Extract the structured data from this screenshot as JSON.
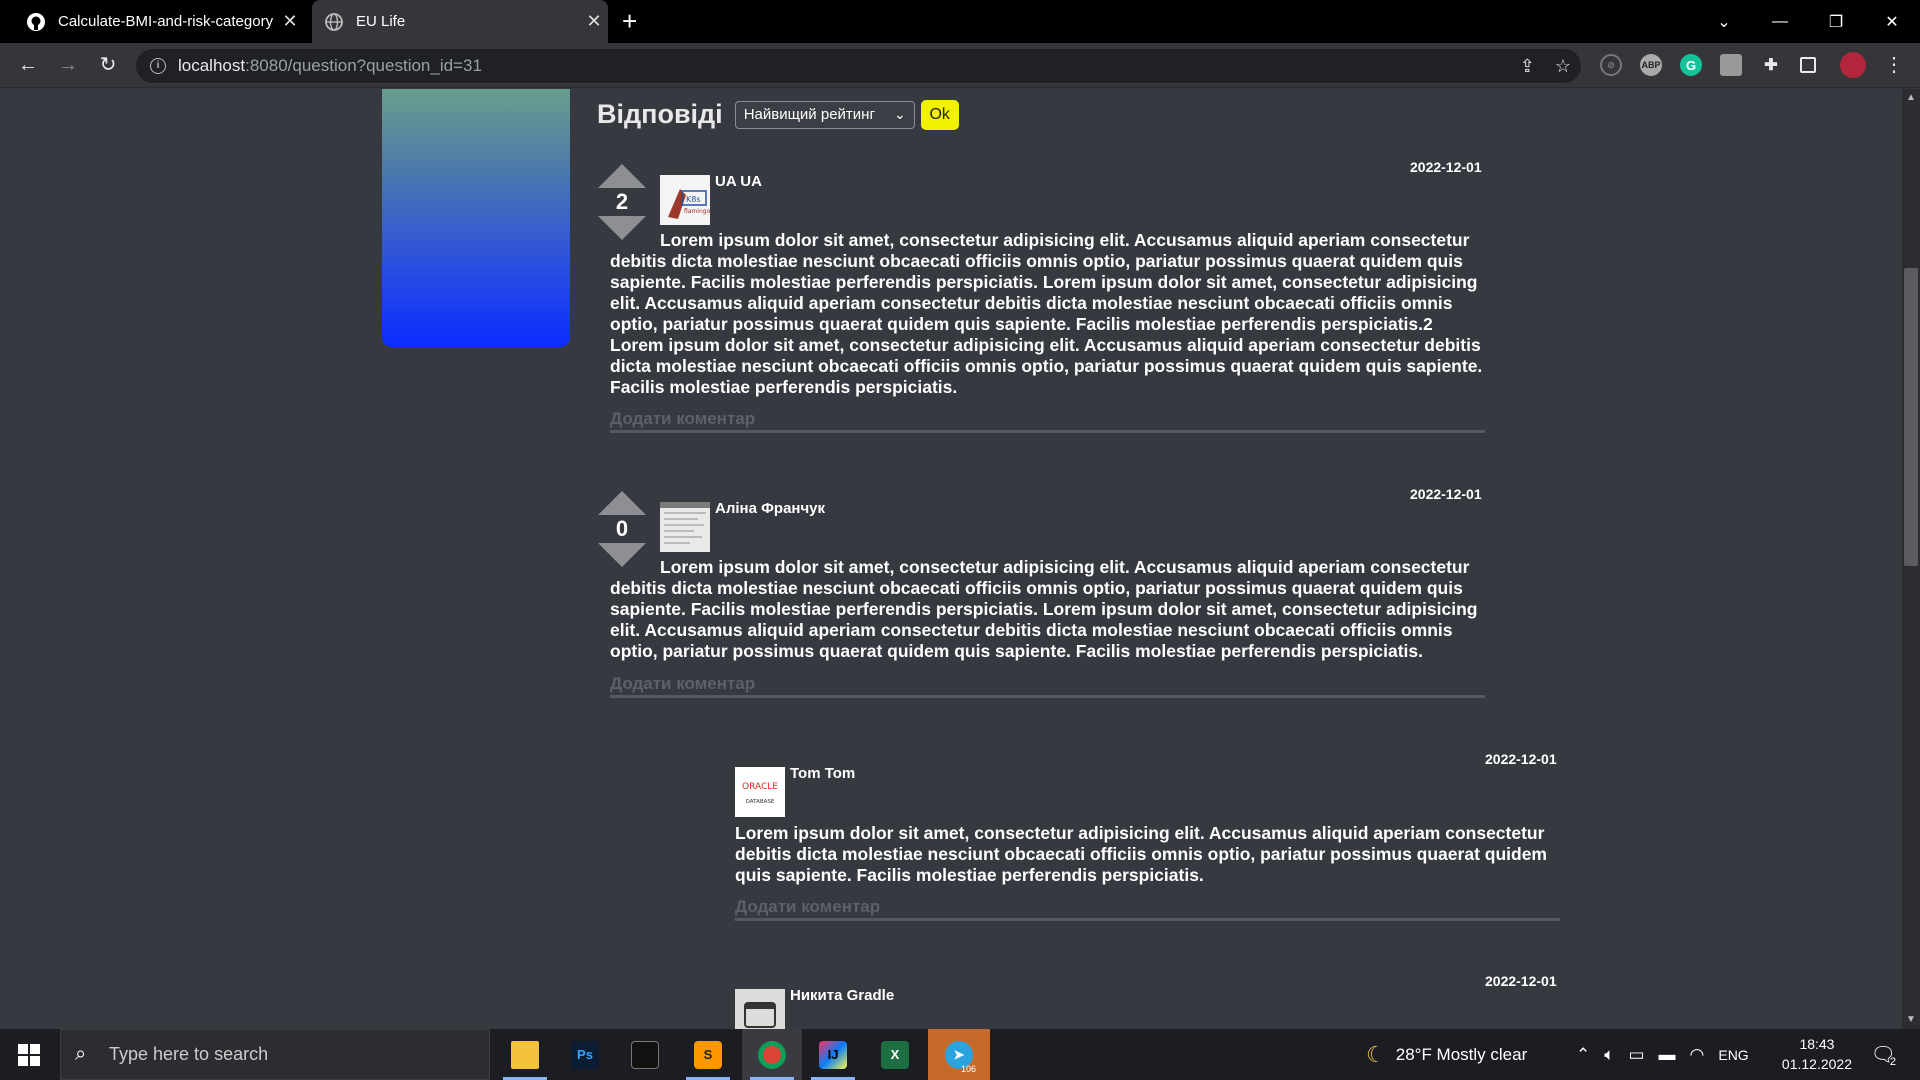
{
  "browser": {
    "tabs": [
      {
        "title": "Calculate-BMI-and-risk-category",
        "icon": "github-icon"
      },
      {
        "title": "EU Life",
        "icon": "globe-icon"
      }
    ],
    "url_host": "localhost",
    "url_rest": ":8080/question?question_id=31"
  },
  "page": {
    "answers_title": "Відповіді",
    "sort_selected": "Найвищий рейтинг",
    "ok_label": "Ok",
    "comment_placeholder": "Додати коментар",
    "answers": [
      {
        "author": "UA UA",
        "date": "2022-12-01",
        "votes": "2",
        "text": "Lorem ipsum dolor sit amet, consectetur adipisicing elit. Accusamus aliquid aperiam consectetur debitis dicta molestiae nesciunt obcaecati officiis omnis optio, pariatur possimus quaerat quidem quis sapiente. Facilis molestiae perferendis perspiciatis. Lorem ipsum dolor sit amet, consectetur adipisicing elit. Accusamus aliquid aperiam consectetur debitis dicta molestiae nesciunt obcaecati officiis omnis optio, pariatur possimus quaerat quidem quis sapiente. Facilis molestiae perferendis perspiciatis.2 Lorem ipsum dolor sit amet, consectetur adipisicing elit. Accusamus aliquid aperiam consectetur debitis dicta molestiae nesciunt obcaecati officiis omnis optio, pariatur possimus quaerat quidem quis sapiente. Facilis molestiae perferendis perspiciatis."
      },
      {
        "author": "Аліна Франчук",
        "date": "2022-12-01",
        "votes": "0",
        "text": "Lorem ipsum dolor sit amet, consectetur adipisicing elit. Accusamus aliquid aperiam consectetur debitis dicta molestiae nesciunt obcaecati officiis omnis optio, pariatur possimus quaerat quidem quis sapiente. Facilis molestiae perferendis perspiciatis. Lorem ipsum dolor sit amet, consectetur adipisicing elit. Accusamus aliquid aperiam consectetur debitis dicta molestiae nesciunt obcaecati officiis omnis optio, pariatur possimus quaerat quidem quis sapiente. Facilis molestiae perferendis perspiciatis."
      }
    ],
    "comments": [
      {
        "author": "Tom Tom",
        "date": "2022-12-01",
        "avatar_text_top": "ORACLE",
        "avatar_text_bottom": "DATABASE",
        "text": "Lorem ipsum dolor sit amet, consectetur adipisicing elit. Accusamus aliquid aperiam consectetur debitis dicta molestiae nesciunt obcaecati officiis omnis optio, pariatur possimus quaerat quidem quis sapiente. Facilis molestiae perferendis perspiciatis."
      },
      {
        "author": "Никита Gradle",
        "date": "2022-12-01"
      }
    ]
  },
  "taskbar": {
    "search_placeholder": "Type here to search",
    "weather": "28°F  Mostly clear",
    "language": "ENG",
    "time": "18:43",
    "date": "01.12.2022",
    "notification_count": "2",
    "telegram_badge": "106"
  }
}
